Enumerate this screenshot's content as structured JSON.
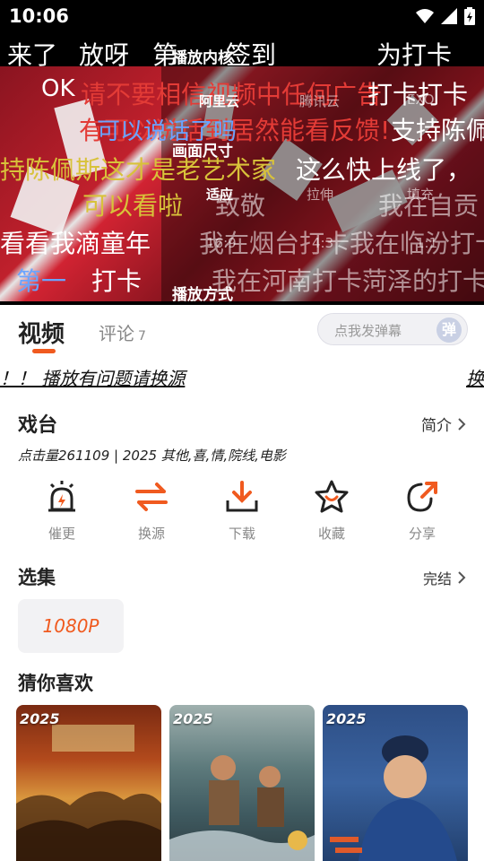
{
  "status_bar": {
    "time": "10:06"
  },
  "player": {
    "danmaku": [
      {
        "text": "来了",
        "color": "white"
      },
      {
        "text": "放呀",
        "color": "white"
      },
      {
        "text": "第",
        "color": "white"
      },
      {
        "text": "签到",
        "color": "white"
      },
      {
        "text": "为打卡",
        "color": "white"
      },
      {
        "text": "OK",
        "color": "white"
      },
      {
        "text": "请不要相信视频中任何广告",
        "color": "red"
      },
      {
        "text": "打卡打卡",
        "color": "white"
      },
      {
        "text": "可以说话了吗",
        "color": "blue"
      },
      {
        "text": "有可以说话到居然能看反馈!",
        "color": "red"
      },
      {
        "text": "支持陈佩",
        "color": "white"
      },
      {
        "text": "持陈佩斯这才是老艺术家",
        "color": "yellow"
      },
      {
        "text": "这么快上线了，",
        "color": "white"
      },
      {
        "text": "可以看啦",
        "color": "yellow"
      },
      {
        "text": "致敬",
        "color": "gray"
      },
      {
        "text": "我在自贡",
        "color": "gray"
      },
      {
        "text": "看看我滴童年",
        "color": "white"
      },
      {
        "text": "我在烟台打卡我在临汾打卡",
        "color": "gray"
      },
      {
        "text": "第一",
        "color": "blue"
      },
      {
        "text": "打卡",
        "color": "white"
      },
      {
        "text": "我在河南打卡菏泽的打卡",
        "color": "gray"
      }
    ],
    "settings": {
      "core_title": "播放内核",
      "core_options": [
        "阿里云",
        "腾讯云",
        "EXO"
      ],
      "size_title": "画面尺寸",
      "size_options": [
        "适应",
        "拉伸",
        "填充",
        "16:9",
        "4:3",
        "1:1"
      ],
      "mode_title": "播放方式"
    }
  },
  "tabs": {
    "video_label": "视频",
    "comment_label": "评论",
    "comment_count": "7",
    "danmu_placeholder": "点我发弹幕",
    "danmu_button": "弹"
  },
  "notice": {
    "text": "！！ 播放有问题请换源",
    "tail": "换"
  },
  "info": {
    "title": "戏台",
    "intro_label": "简介",
    "meta": "点击量261109 | 2025 其他,喜,情,院线,电影"
  },
  "actions": [
    {
      "label": "催更",
      "icon": "alarm-icon"
    },
    {
      "label": "换源",
      "icon": "swap-icon"
    },
    {
      "label": "下载",
      "icon": "download-icon"
    },
    {
      "label": "收藏",
      "icon": "star-icon"
    },
    {
      "label": "分享",
      "icon": "share-icon"
    }
  ],
  "episodes": {
    "title": "选集",
    "status_label": "完结",
    "items": [
      "1080P"
    ]
  },
  "recommendations": {
    "title": "猜你喜欢",
    "items": [
      {
        "year": "2025"
      },
      {
        "year": "2025"
      },
      {
        "year": "2025"
      }
    ]
  },
  "colors": {
    "accent": "#f05a1f",
    "text_primary": "#222222",
    "text_secondary": "#888888"
  }
}
